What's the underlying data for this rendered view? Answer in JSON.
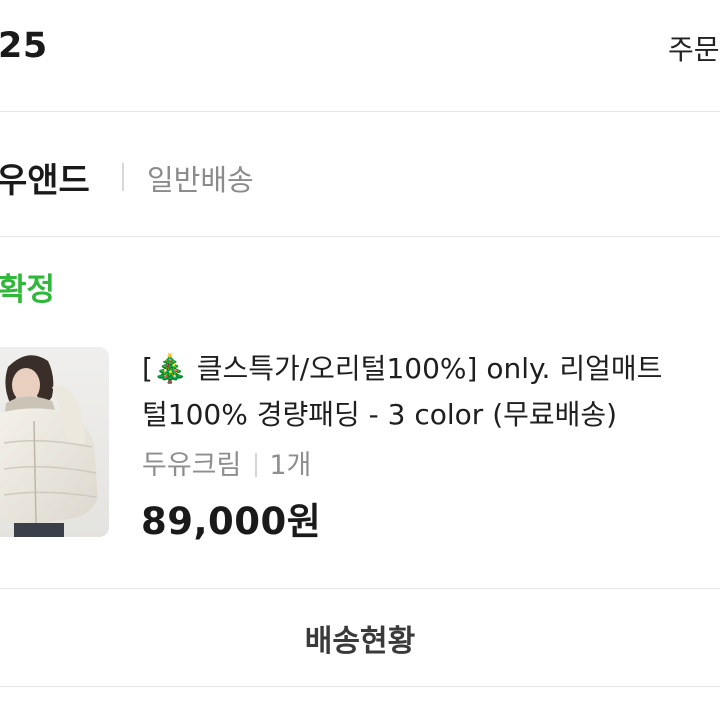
{
  "header": {
    "order_date": "25",
    "detail_link": "주문"
  },
  "seller": {
    "name": "우앤드",
    "shipping_type": "일반배송"
  },
  "order": {
    "status": "확정"
  },
  "product": {
    "title_line1": "[🎄 클스특가/오리털100%] only. 리얼매트",
    "title_line2": "털100% 경량패딩 - 3 color (무료배송)",
    "option": "두유크림",
    "quantity": "1개",
    "price": "89,000원"
  },
  "actions": {
    "track_label": "배송현황"
  },
  "colors": {
    "status_green": "#2fb83a",
    "divider": "#e6e6e6",
    "muted_text": "#8e8e8e"
  }
}
